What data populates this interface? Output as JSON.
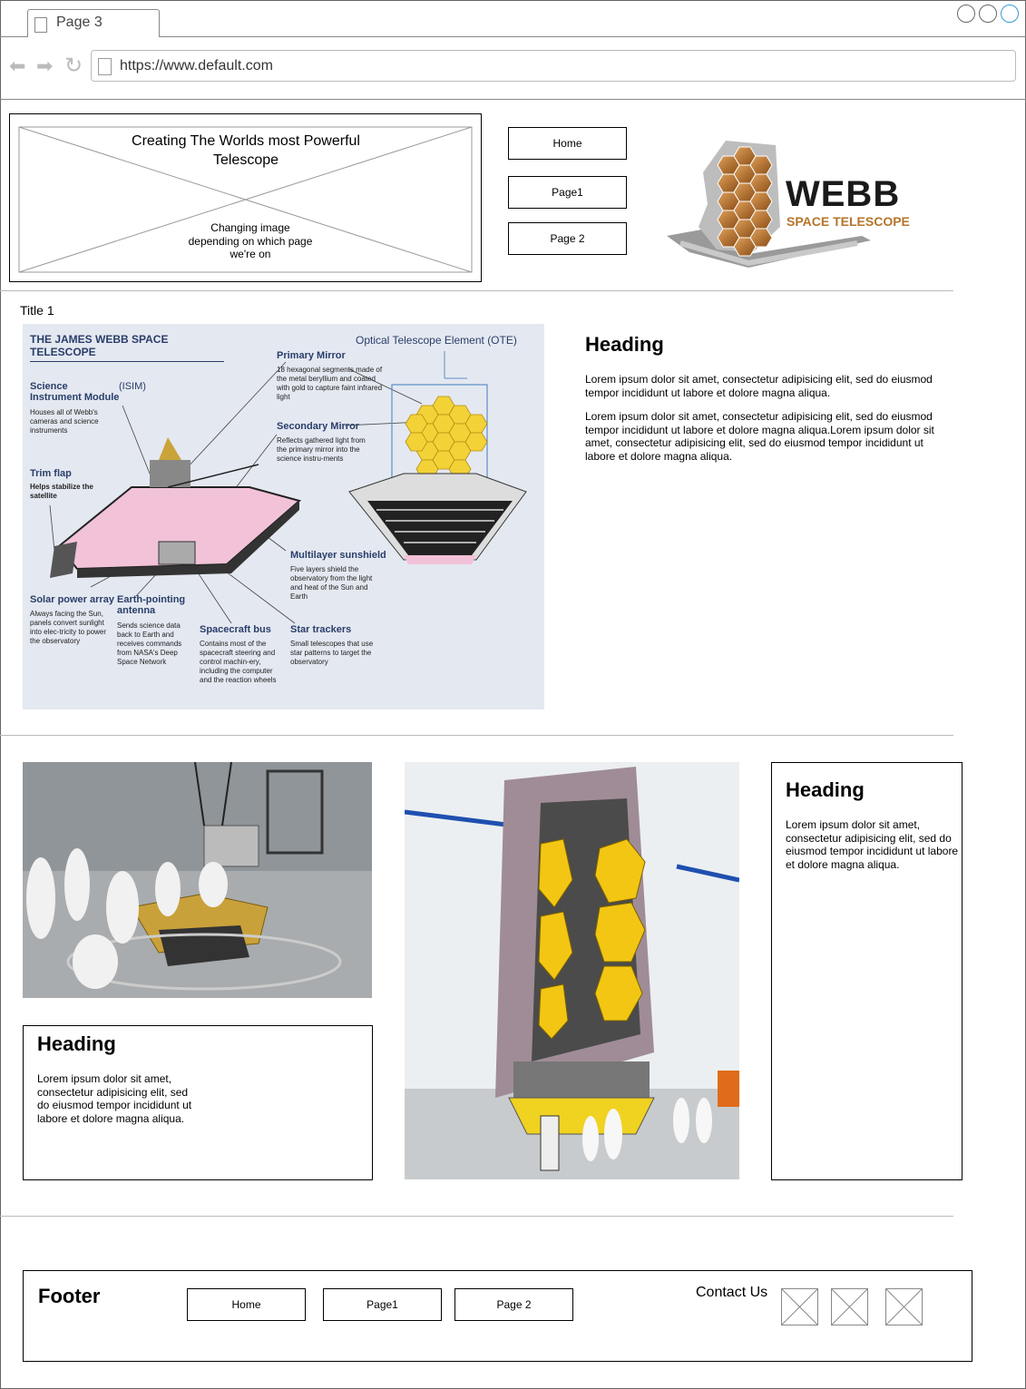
{
  "browser": {
    "tab_title": "Page 3",
    "url": "https://www.default.com"
  },
  "header": {
    "hero_title": "Creating The Worlds most Powerful Telescope",
    "hero_note": "Changing image depending on which page we're on",
    "nav": [
      "Home",
      "Page1",
      "Page 2"
    ],
    "logo": {
      "word": "WEBB",
      "sub": "SPACE TELESCOPE",
      "accent": "#b5752a",
      "dark": "#1a1a1a"
    }
  },
  "section1": {
    "title": "Title 1",
    "heading": "Heading",
    "para1": "Lorem ipsum dolor sit amet, consectetur adipisicing elit, sed do eiusmod tempor incididunt ut labore et dolore magna aliqua.",
    "para2": "Lorem ipsum dolor sit amet, consectetur adipisicing elit, sed do eiusmod tempor incididunt ut labore et dolore magna aliqua.Lorem ipsum dolor sit amet, consectetur adipisicing elit, sed do eiusmod tempor incididunt ut labore et dolore magna aliqua.",
    "diagram": {
      "title": "THE JAMES WEBB SPACE TELESCOPE",
      "ote": "Optical Telescope Element (OTE)",
      "primary_mirror": "Primary Mirror",
      "primary_mirror_desc": "18 hexagonal segments made of the metal beryllium and coated with gold to capture faint infrared light",
      "isim": "Science Instrument Module",
      "isim_abbr": "(ISIM)",
      "isim_desc": "Houses all of Webb's cameras and science instruments",
      "secondary_mirror": "Secondary Mirror",
      "secondary_mirror_desc": "Reflects gathered light from the primary mirror into the science instru-ments",
      "trim_flap": "Trim flap",
      "trim_flap_desc": "Helps stabilize the satellite",
      "sunshield": "Multilayer sunshield",
      "sunshield_desc": "Five layers shield the observatory from the light and heat of the Sun and Earth",
      "solar": "Solar power array",
      "solar_desc": "Always facing the Sun, panels convert sunlight into elec-tricity to power the observatory",
      "antenna": "Earth-pointing antenna",
      "antenna_desc": "Sends science data back to Earth and receives commands from NASA's Deep Space Network",
      "bus": "Spacecraft bus",
      "bus_desc": "Contains most of the spacecraft steering and control machin-ery, including the computer and the reaction wheels",
      "trackers": "Star trackers",
      "trackers_desc": "Small telescopes that use star patterns to target the observatory"
    }
  },
  "section2": {
    "card1": {
      "heading": "Heading",
      "text": "Lorem ipsum dolor sit amet, consectetur adipisicing elit, sed do eiusmod tempor incididunt ut labore et dolore magna aliqua."
    },
    "card2": {
      "heading": "Heading",
      "text": "Lorem ipsum dolor sit amet, consectetur adipisicing elit, sed do eiusmod tempor incididunt ut labore et dolore magna aliqua."
    }
  },
  "footer": {
    "title": "Footer",
    "nav": [
      "Home",
      "Page1",
      "Page 2"
    ],
    "contact": "Contact Us"
  }
}
